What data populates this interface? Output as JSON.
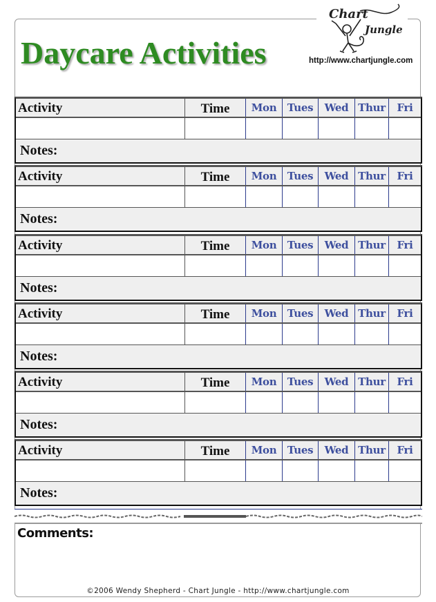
{
  "header": {
    "title": "Daycare Activities",
    "logo_text_top": "Chart",
    "logo_text_bottom": "Jungle",
    "logo_url": "http://www.chartjungle.com"
  },
  "columns": {
    "activity": "Activity",
    "time": "Time",
    "days": [
      "Mon",
      "Tues",
      "Wed",
      "Thur",
      "Fri"
    ]
  },
  "notes_label": "Notes:",
  "blocks": [
    {
      "activity": "",
      "time": "",
      "days": [
        "",
        "",
        "",
        "",
        ""
      ],
      "notes": ""
    },
    {
      "activity": "",
      "time": "",
      "days": [
        "",
        "",
        "",
        "",
        ""
      ],
      "notes": ""
    },
    {
      "activity": "",
      "time": "",
      "days": [
        "",
        "",
        "",
        "",
        ""
      ],
      "notes": ""
    },
    {
      "activity": "",
      "time": "",
      "days": [
        "",
        "",
        "",
        "",
        ""
      ],
      "notes": ""
    },
    {
      "activity": "",
      "time": "",
      "days": [
        "",
        "",
        "",
        "",
        ""
      ],
      "notes": ""
    },
    {
      "activity": "",
      "time": "",
      "days": [
        "",
        "",
        "",
        "",
        ""
      ],
      "notes": ""
    }
  ],
  "comments": {
    "label": "Comments:",
    "value": ""
  },
  "footer": "©2006 Wendy Shepherd - Chart Jungle - http://www.chartjungle.com",
  "colors": {
    "title_green": "#2e8b22",
    "day_blue": "#3d4f9e",
    "header_gray": "#efefef"
  }
}
